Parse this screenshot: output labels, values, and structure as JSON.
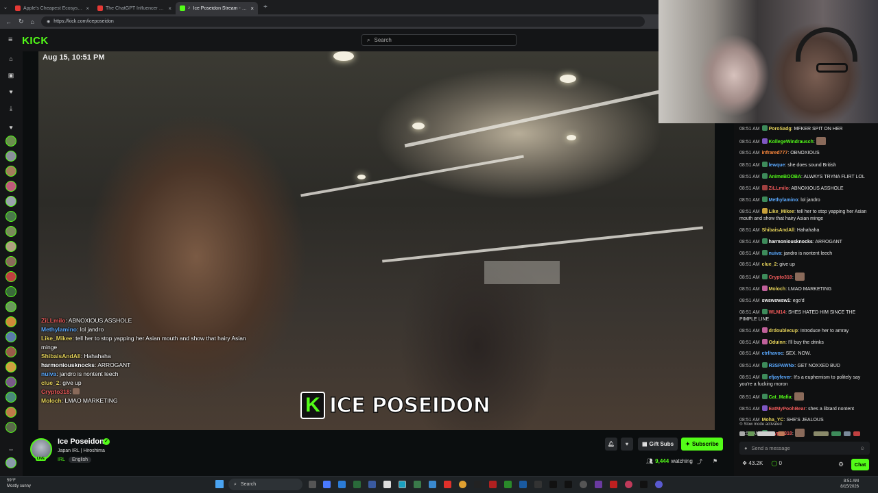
{
  "browser": {
    "tabs": [
      {
        "label": "Apple's Cheapest Ecosystem Brok",
        "favicon_color": "#e53935",
        "active": false
      },
      {
        "label": "The ChatGPT Influencer Trip Just",
        "favicon_color": "#e53935",
        "active": false
      },
      {
        "label": "Ice Poseidon Stream - Watch",
        "favicon_color": "#53fc18",
        "active": true
      }
    ],
    "url": "https://kick.com/iceposeidon"
  },
  "header": {
    "logo": "KICK",
    "search_placeholder": "Search"
  },
  "video": {
    "timestamp": "Aug 15, 10:51 PM",
    "brand_text": "ICE POSEIDON",
    "brand_letter": "K",
    "overlay_chat": [
      {
        "user": "ZiLLmilo",
        "text": "ABNOXIOUS ASSHOLE",
        "color": "#f05a5a"
      },
      {
        "user": "Methylamino",
        "text": "lol jandro",
        "color": "#5aa9ff"
      },
      {
        "user": "Like_Mikee",
        "text": "tell her to stop yapping her Asian mouth and show that hairy Asian minge",
        "color": "#e6d35a"
      },
      {
        "user": "ShibaisAndAll",
        "text": "Hahahaha",
        "color": "#e6d35a"
      },
      {
        "user": "harmoniousknocks",
        "text": "ARROGANT",
        "color": "#ffffff"
      },
      {
        "user": "nuiva",
        "text": "jandro is nontent leech",
        "color": "#5aa9ff"
      },
      {
        "user": "clue_2",
        "text": "give up",
        "color": "#e6d35a"
      },
      {
        "user": "Crypto318",
        "text": "",
        "color": "#f05a5a"
      },
      {
        "user": "Moloch",
        "text": "LMAO MARKETING",
        "color": "#e6d35a"
      }
    ]
  },
  "stream": {
    "name": "Ice Poseidon",
    "title": "Japan IRL | Hiroshima",
    "category": "IRL",
    "tag": "English",
    "live_label": "LIVE",
    "gift_subs": "Gift Subs",
    "subscribe": "Subscribe",
    "viewers": "9,444",
    "viewers_label": "watching"
  },
  "chat": {
    "messages": [
      {
        "time": "08:51 AM",
        "user": "PoroSadg",
        "text": "MFKER SPIT ON HER",
        "color": "#e6d35a",
        "badge": "#3d8b5a"
      },
      {
        "time": "08:51 AM",
        "user": "KollegeWindrausch",
        "text": "",
        "color": "#53fc18",
        "badge": "#7e57c2"
      },
      {
        "time": "08:51 AM",
        "user": "infrared777",
        "text": "OBNOXIOUS",
        "color": "#ff8a3d",
        "badge": ""
      },
      {
        "time": "08:51 AM",
        "user": "lewque",
        "text": "she does sound British",
        "color": "#5aa9ff",
        "badge": "#3d8b5a"
      },
      {
        "time": "08:51 AM",
        "user": "AnimeBOOBA",
        "text": "ALWAYS TRYNA FLIRT LOL",
        "color": "#53fc18",
        "badge": "#3d8b5a"
      },
      {
        "time": "08:51 AM",
        "user": "ZiLLmilo",
        "text": "ABNOXIOUS ASSHOLE",
        "color": "#f05a5a",
        "badge": "#a04040"
      },
      {
        "time": "08:51 AM",
        "user": "Methylamino",
        "text": "lol jandro",
        "color": "#5aa9ff",
        "badge": "#3d8b5a"
      },
      {
        "time": "08:51 AM",
        "user": "Like_Mikee",
        "text": "tell her to stop yapping her Asian mouth and show that hairy Asian minge",
        "color": "#e6d35a",
        "badge": "#c9a13b"
      },
      {
        "time": "08:51 AM",
        "user": "ShibaisAndAll",
        "text": "Hahahaha",
        "color": "#e6d35a",
        "badge": ""
      },
      {
        "time": "08:51 AM",
        "user": "harmoniousknocks",
        "text": "ARROGANT",
        "color": "#ffffff",
        "badge": "#3d8b5a"
      },
      {
        "time": "08:51 AM",
        "user": "nuiva",
        "text": "jandro is nontent leech",
        "color": "#5aa9ff",
        "badge": "#3d8b5a"
      },
      {
        "time": "08:51 AM",
        "user": "clue_2",
        "text": "give up",
        "color": "#e6d35a",
        "badge": ""
      },
      {
        "time": "08:51 AM",
        "user": "Crypto318",
        "text": "",
        "color": "#f05a5a",
        "badge": "#3d8b5a"
      },
      {
        "time": "08:51 AM",
        "user": "Moloch",
        "text": "LMAO MARKETING",
        "color": "#e6d35a",
        "badge": "#c0609a"
      },
      {
        "time": "08:51 AM",
        "user": "swswswsw1",
        "text": "ego'd",
        "color": "#ffffff",
        "badge": ""
      },
      {
        "time": "08:51 AM",
        "user": "WLM14",
        "text": "SHES HATED HIM SINCE THE PIMPLE LINE",
        "color": "#f05a5a",
        "badge": "#3d8b5a"
      },
      {
        "time": "08:51 AM",
        "user": "drdoublecup",
        "text": "Introduce her to amray",
        "color": "#e6d35a",
        "badge": "#c0609a"
      },
      {
        "time": "08:51 AM",
        "user": "Oduinn",
        "text": "I'll buy the drinks",
        "color": "#e6d35a",
        "badge": "#c0609a"
      },
      {
        "time": "08:51 AM",
        "user": "ctrlhavoc",
        "text": "SEX. NOW.",
        "color": "#5aa9ff",
        "badge": ""
      },
      {
        "time": "08:51 AM",
        "user": "R3SPAWNx",
        "text": "GET NOXXED BUD",
        "color": "#5aa9ff",
        "badge": "#3d8b5a"
      },
      {
        "time": "08:51 AM",
        "user": "efjayfever",
        "text": "It's a euphemism to politely say you're a fucking moron",
        "color": "#5aa9ff",
        "badge": "#3d8b5a"
      },
      {
        "time": "08:51 AM",
        "user": "Cat_Mafia",
        "text": "",
        "color": "#53fc18",
        "badge": "#3d8b5a"
      },
      {
        "time": "08:51 AM",
        "user": "EatMyPoohBear",
        "text": "shes a libtard nontent",
        "color": "#f05a5a",
        "badge": "#7e57c2"
      },
      {
        "time": "08:51 AM",
        "user": "Moha_YC",
        "text": "SHE'S JEALOUS",
        "color": "#e6d35a",
        "badge": ""
      },
      {
        "time": "08:51 AM",
        "user": "Crypto318",
        "text": "",
        "color": "#f05a5a",
        "badge": "#3d8b5a"
      }
    ],
    "slow_mode": "Slow mode activated",
    "input_placeholder": "Send a message",
    "points": "43.2K",
    "other_count": "0",
    "chat_button": "Chat"
  },
  "taskbar": {
    "weather_temp": "59°F",
    "weather_desc": "Mostly sunny",
    "search_label": "Search",
    "time": "8:51 AM",
    "date": "8/15/2026"
  }
}
